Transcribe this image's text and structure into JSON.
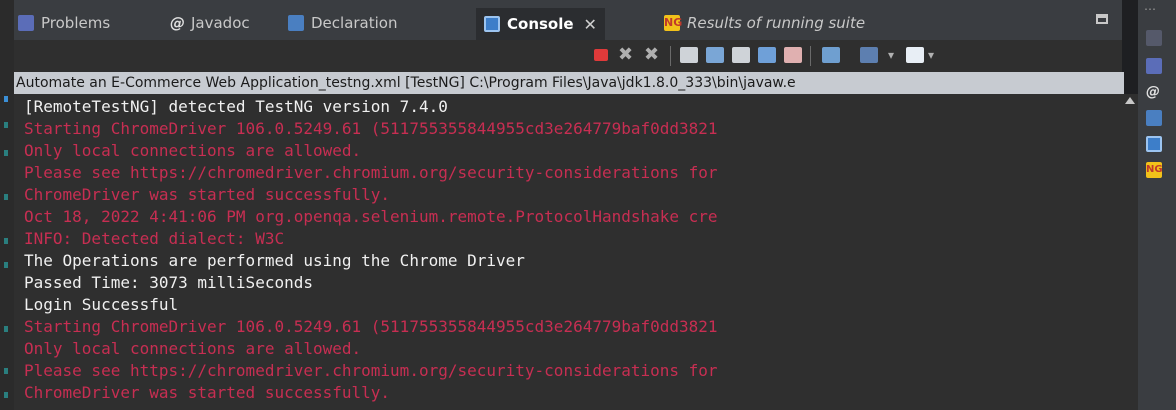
{
  "tabs": [
    {
      "label": "Problems",
      "icon": "problems-icon"
    },
    {
      "label": "Javadoc",
      "icon": "javadoc-icon"
    },
    {
      "label": "Declaration",
      "icon": "declaration-icon"
    },
    {
      "label": "Console",
      "icon": "console-icon",
      "active": true
    },
    {
      "label": "Results of running suite",
      "icon": "testng-icon"
    }
  ],
  "console_path": "Automate an E-Commerce Web Application_testng.xml [TestNG] C:\\Program Files\\Java\\jdk1.8.0_333\\bin\\javaw.e",
  "console_lines": [
    {
      "text": "[RemoteTestNG] detected TestNG version 7.4.0",
      "stream": "out"
    },
    {
      "text": "Starting ChromeDriver 106.0.5249.61 (511755355844955cd3e264779baf0dd3821",
      "stream": "err"
    },
    {
      "text": "Only local connections are allowed.",
      "stream": "err"
    },
    {
      "text": "Please see https://chromedriver.chromium.org/security-considerations for",
      "stream": "err"
    },
    {
      "text": "ChromeDriver was started successfully.",
      "stream": "err"
    },
    {
      "text": "Oct 18, 2022 4:41:06 PM org.openqa.selenium.remote.ProtocolHandshake cre",
      "stream": "err"
    },
    {
      "text": "INFO: Detected dialect: W3C",
      "stream": "err"
    },
    {
      "text": "The Operations are performed using the Chrome Driver",
      "stream": "out"
    },
    {
      "text": "Passed Time: 3073 milliSeconds",
      "stream": "out"
    },
    {
      "text": "Login Successful",
      "stream": "out"
    },
    {
      "text": "Starting ChromeDriver 106.0.5249.61 (511755355844955cd3e264779baf0dd3821",
      "stream": "err"
    },
    {
      "text": "Only local connections are allowed.",
      "stream": "err"
    },
    {
      "text": "Please see https://chromedriver.chromium.org/security-considerations for",
      "stream": "err"
    },
    {
      "text": "ChromeDriver was started successfully.",
      "stream": "err"
    }
  ],
  "colors": {
    "stdout": "#f0f0f0",
    "stderr": "#c72e52",
    "console_bg": "#2f2f2f",
    "tabbar_bg": "#3a3d41",
    "path_bg": "#c7cbd1"
  },
  "toolbar_icons": [
    "terminate-icon",
    "remove-launch-icon",
    "remove-all-terminated-icon",
    "scroll-lock-icon",
    "word-wrap-icon",
    "show-on-stdout-icon",
    "show-on-stderr-icon",
    "pin-console-icon",
    "display-selected-console-icon",
    "open-console-icon",
    "view-menu-icon"
  ]
}
